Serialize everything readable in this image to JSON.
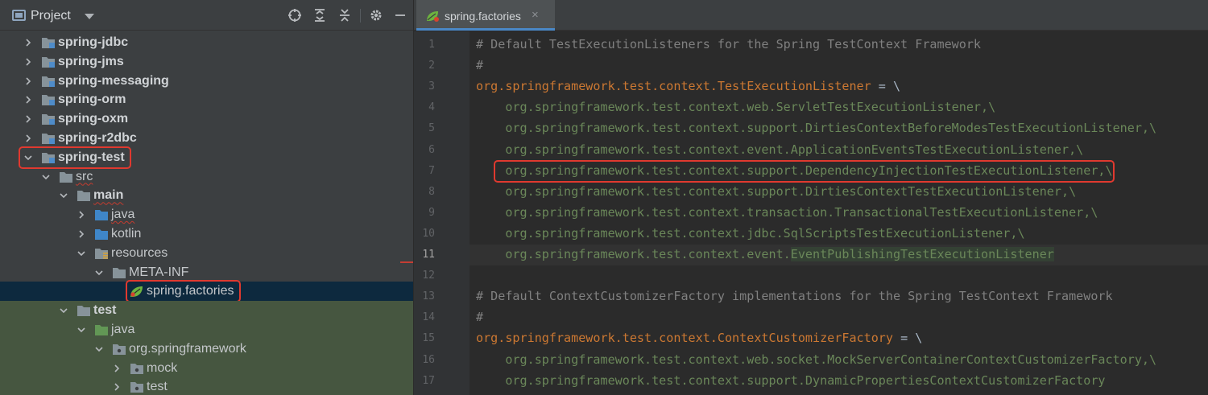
{
  "project_panel": {
    "title": "Project",
    "tree": [
      {
        "label": "spring-jdbc",
        "bold": true,
        "depth": 0,
        "expanded": false,
        "folder": "module"
      },
      {
        "label": "spring-jms",
        "bold": true,
        "depth": 0,
        "expanded": false,
        "folder": "module"
      },
      {
        "label": "spring-messaging",
        "bold": true,
        "depth": 0,
        "expanded": false,
        "folder": "module"
      },
      {
        "label": "spring-orm",
        "bold": true,
        "depth": 0,
        "expanded": false,
        "folder": "module"
      },
      {
        "label": "spring-oxm",
        "bold": true,
        "depth": 0,
        "expanded": false,
        "folder": "module"
      },
      {
        "label": "spring-r2dbc",
        "bold": true,
        "depth": 0,
        "expanded": false,
        "folder": "module"
      },
      {
        "label": "spring-test",
        "bold": true,
        "depth": 0,
        "expanded": true,
        "folder": "module",
        "highlighted": true
      },
      {
        "label": "src",
        "bold": false,
        "depth": 1,
        "expanded": true,
        "folder": "plain",
        "squiggle": true
      },
      {
        "label": "main",
        "bold": true,
        "depth": 2,
        "expanded": true,
        "folder": "plain",
        "squiggle": true
      },
      {
        "label": "java",
        "bold": false,
        "depth": 3,
        "expanded": false,
        "folder": "source",
        "squiggle": true
      },
      {
        "label": "kotlin",
        "bold": false,
        "depth": 3,
        "expanded": false,
        "folder": "source"
      },
      {
        "label": "resources",
        "bold": false,
        "depth": 3,
        "expanded": true,
        "folder": "resources"
      },
      {
        "label": "META-INF",
        "bold": false,
        "depth": 4,
        "expanded": true,
        "folder": "plain"
      },
      {
        "label": "spring.factories",
        "bold": false,
        "depth": 5,
        "file": true,
        "selected": true,
        "highlighted": true
      },
      {
        "label": "test",
        "bold": true,
        "depth": 2,
        "expanded": true,
        "folder": "plain",
        "test_bg": true
      },
      {
        "label": "java",
        "bold": false,
        "depth": 3,
        "expanded": true,
        "folder": "test-source",
        "test_bg": true
      },
      {
        "label": "org.springframework",
        "bold": false,
        "depth": 4,
        "expanded": true,
        "folder": "package",
        "test_bg": true
      },
      {
        "label": "mock",
        "bold": false,
        "depth": 5,
        "expanded": false,
        "folder": "package",
        "test_bg": true
      },
      {
        "label": "test",
        "bold": false,
        "depth": 5,
        "expanded": false,
        "folder": "package",
        "test_bg": true
      }
    ]
  },
  "editor": {
    "tab_label": "spring.factories",
    "tab_close": "×",
    "current_line": 11,
    "lines": [
      {
        "n": "1",
        "parts": [
          {
            "t": "# Default TestExecutionListeners for the Spring TestContext Framework",
            "c": "comment"
          }
        ]
      },
      {
        "n": "2",
        "parts": [
          {
            "t": "#",
            "c": "comment"
          }
        ]
      },
      {
        "n": "3",
        "parts": [
          {
            "t": "org.springframework.test.context.TestExecutionListener",
            "c": "key"
          },
          {
            "t": " = \\",
            "c": "eq"
          }
        ]
      },
      {
        "n": "4",
        "parts": [
          {
            "t": "    org.springframework.test.context.web.ServletTestExecutionListener,\\",
            "c": "val"
          }
        ]
      },
      {
        "n": "5",
        "parts": [
          {
            "t": "    org.springframework.test.context.support.DirtiesContextBeforeModesTestExecutionListener,\\",
            "c": "val"
          }
        ]
      },
      {
        "n": "6",
        "parts": [
          {
            "t": "    org.springframework.test.context.event.ApplicationEventsTestExecutionListener,\\",
            "c": "val"
          }
        ]
      },
      {
        "n": "7",
        "parts": [
          {
            "t": "    org.springframework.test.context.support.DependencyInjectionTestExecutionListener,\\",
            "c": "val"
          }
        ],
        "boxed": true
      },
      {
        "n": "8",
        "parts": [
          {
            "t": "    org.springframework.test.context.support.DirtiesContextTestExecutionListener,\\",
            "c": "val"
          }
        ]
      },
      {
        "n": "9",
        "parts": [
          {
            "t": "    org.springframework.test.context.transaction.TransactionalTestExecutionListener,\\",
            "c": "val"
          }
        ]
      },
      {
        "n": "10",
        "parts": [
          {
            "t": "    org.springframework.test.context.jdbc.SqlScriptsTestExecutionListener,\\",
            "c": "val"
          }
        ]
      },
      {
        "n": "11",
        "parts": [
          {
            "t": "    org.springframework.test.context.event.",
            "c": "val"
          },
          {
            "t": "EventPublishingTestExecutionListener",
            "c": "val-hl"
          }
        ]
      },
      {
        "n": "12",
        "parts": []
      },
      {
        "n": "13",
        "parts": [
          {
            "t": "# Default ContextCustomizerFactory implementations for the Spring TestContext Framework",
            "c": "comment"
          }
        ]
      },
      {
        "n": "14",
        "parts": [
          {
            "t": "#",
            "c": "comment"
          }
        ]
      },
      {
        "n": "15",
        "parts": [
          {
            "t": "org.springframework.test.context.ContextCustomizerFactory",
            "c": "key"
          },
          {
            "t": " = \\",
            "c": "eq"
          }
        ]
      },
      {
        "n": "16",
        "parts": [
          {
            "t": "    org.springframework.test.context.web.socket.MockServerContainerContextCustomizerFactory,\\",
            "c": "val"
          }
        ]
      },
      {
        "n": "17",
        "parts": [
          {
            "t": "    org.springframework.test.context.support.DynamicPropertiesContextCustomizerFactory",
            "c": "val"
          }
        ]
      }
    ]
  },
  "colors": {
    "comment": "#808080",
    "key": "#cc7832",
    "value": "#6a8759",
    "highlight_box": "#e0392f",
    "selection": "#0d293e"
  }
}
